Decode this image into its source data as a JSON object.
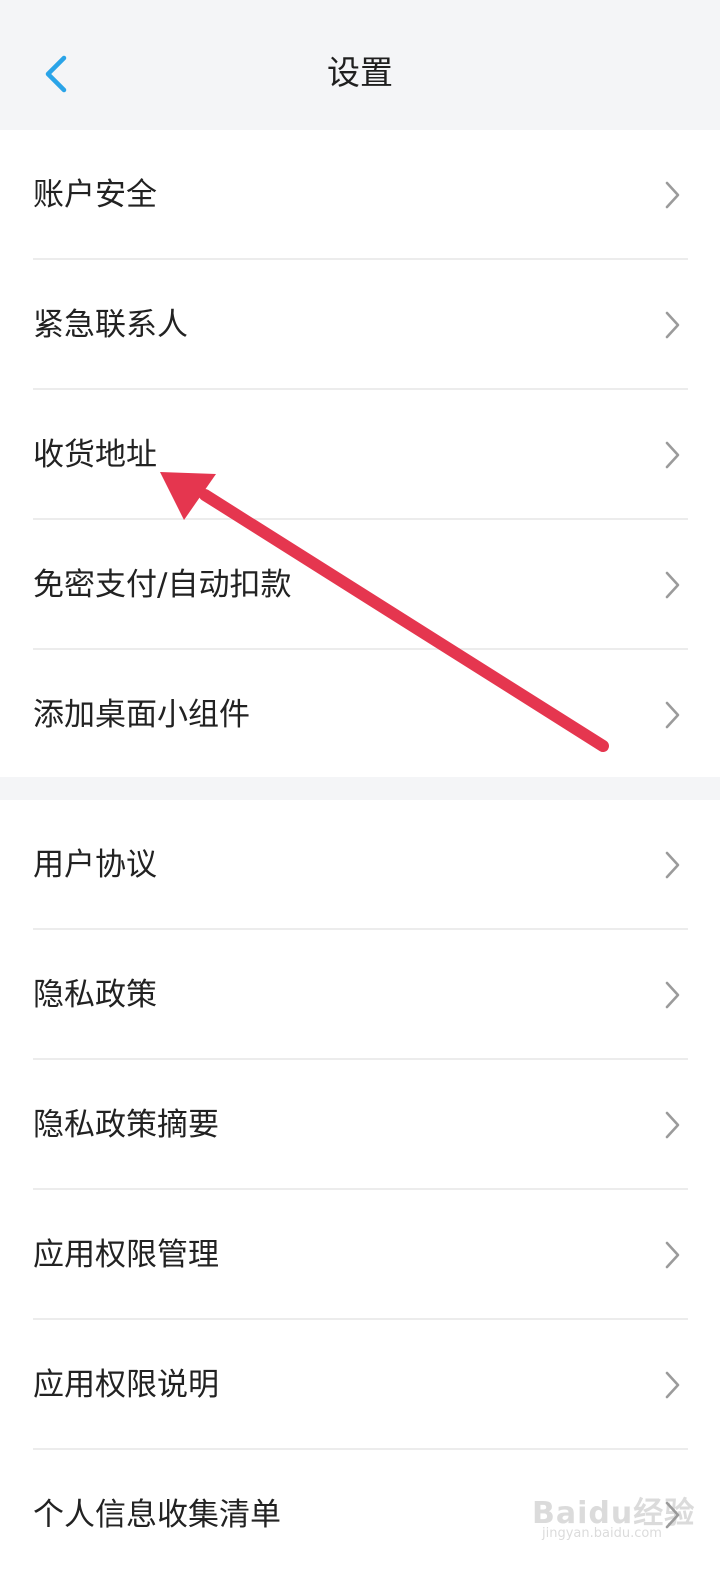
{
  "header": {
    "title": "设置",
    "back_icon": "chevron-left-icon",
    "accent_color": "#2aa4e8"
  },
  "settings_group_1": [
    {
      "label": "账户安全"
    },
    {
      "label": "紧急联系人"
    },
    {
      "label": "收货地址"
    },
    {
      "label": "免密支付/自动扣款"
    },
    {
      "label": "添加桌面小组件"
    }
  ],
  "settings_group_2": [
    {
      "label": "用户协议"
    },
    {
      "label": "隐私政策"
    },
    {
      "label": "隐私政策摘要"
    },
    {
      "label": "应用权限管理"
    },
    {
      "label": "应用权限说明"
    },
    {
      "label": "个人信息收集清单"
    }
  ],
  "row_icon": "chevron-right-icon",
  "annotation": {
    "type": "red-arrow",
    "color": "#e5364f",
    "points_to": "收货地址"
  },
  "watermark": {
    "logo_text": "Baidu经验",
    "url_text": "jingyan.baidu.com"
  }
}
